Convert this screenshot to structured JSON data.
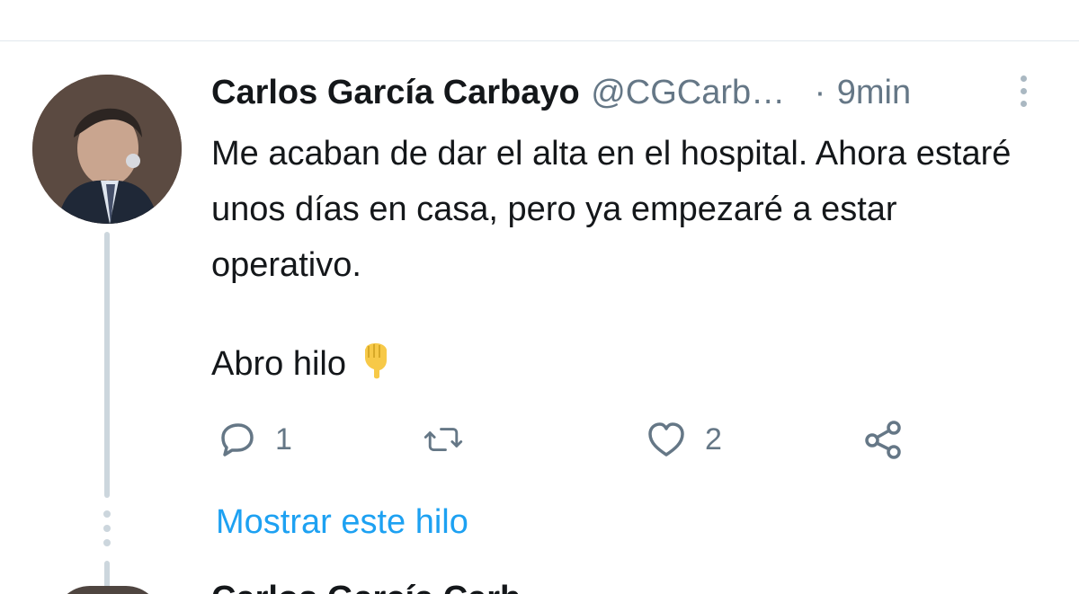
{
  "tweet": {
    "author_name": "Carlos García Carbayo",
    "author_handle": "@CGCarb…",
    "separator": "·",
    "time": "9min",
    "text_main": "Me acaban de dar el alta en el hospital. Ahora estaré unos días en casa, pero ya empezaré a estar operativo.",
    "text_thread": "Abro hilo",
    "emoji": "pointing-down-emoji",
    "actions": {
      "reply_count": "1",
      "retweet_count": "",
      "like_count": "2"
    },
    "show_thread_label": "Mostrar este hilo"
  },
  "icons": {
    "reply": "reply-icon",
    "retweet": "retweet-icon",
    "like": "heart-icon",
    "share": "share-icon",
    "more": "more-vertical-icon"
  },
  "colors": {
    "accent": "#1da1f2",
    "muted": "#657786",
    "line": "#ccd6dd",
    "emoji": "#f7c948"
  },
  "next_tweet_preview": "Carlos García Carb..."
}
